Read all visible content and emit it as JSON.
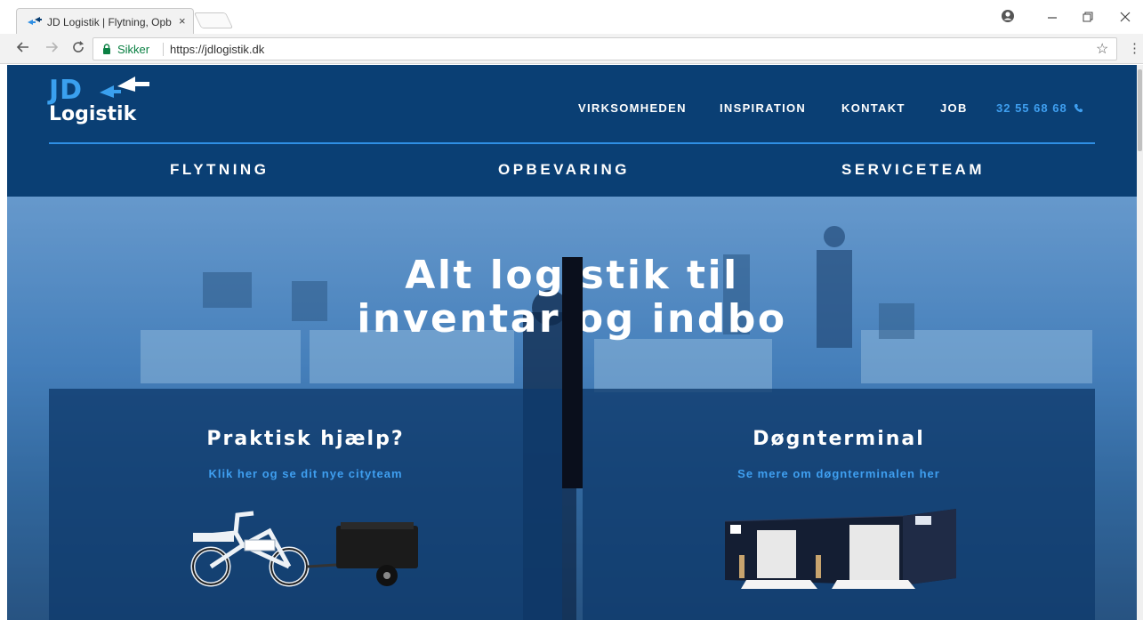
{
  "browser": {
    "tab_title": "JD Logistik | Flytning, Opbevaring",
    "tab_close": "×",
    "secure_label": "Sikker",
    "url": "https://jdlogistik.dk",
    "icons": {
      "back": "back-arrow-icon",
      "forward": "forward-arrow-icon",
      "reload": "reload-icon",
      "lock": "lock-icon",
      "star": "star-icon",
      "menu": "kebab-menu-icon",
      "profile": "profile-icon"
    }
  },
  "site": {
    "logo_jd": "JD",
    "logo_name": "Logistik",
    "top_nav": [
      "VIRKSOMHEDEN",
      "INSPIRATION",
      "KONTAKT",
      "JOB"
    ],
    "phone": "32 55 68 68",
    "main_nav": [
      "FLYTNING",
      "OPBEVARING",
      "SERVICETEAM"
    ],
    "accent": "#3f9ff0",
    "header_bg": "#0a3f74"
  },
  "hero": {
    "title_line1": "Alt logistik til",
    "title_line2": "inventar og indbo"
  },
  "cards": [
    {
      "title": "Praktisk hjælp?",
      "link": "Klik her og se dit nye cityteam",
      "image": "cargo-bike-with-trailer"
    },
    {
      "title": "Døgnterminal",
      "link": "Se mere om døgnterminalen her",
      "image": "storage-container-with-doors"
    }
  ]
}
